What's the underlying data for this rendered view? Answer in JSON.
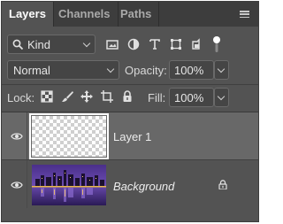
{
  "tabs": [
    {
      "label": "Layers",
      "active": true
    },
    {
      "label": "Channels",
      "active": false
    },
    {
      "label": "Paths",
      "active": false
    }
  ],
  "panel_menu_icon": "hamburger-menu-icon",
  "filter": {
    "search_icon": "search-icon",
    "kind_label": "Kind",
    "filter_icons": [
      "image-filter-icon",
      "adjustment-filter-icon",
      "type-filter-icon",
      "shape-filter-icon",
      "smart-object-filter-icon"
    ],
    "toggle_icon": "filter-toggle-icon"
  },
  "blend": {
    "mode": "Normal",
    "opacity_label": "Opacity:",
    "opacity_value": "100%"
  },
  "lock": {
    "label": "Lock:",
    "icons": [
      "lock-transparent-pixels-icon",
      "lock-image-pixels-icon",
      "lock-position-icon",
      "artboard-nesting-icon",
      "lock-all-icon"
    ],
    "fill_label": "Fill:",
    "fill_value": "100%"
  },
  "layers": [
    {
      "name": "Layer 1",
      "selected": true,
      "visible": true,
      "thumbnail": "transparent",
      "locked": false
    },
    {
      "name": "Background",
      "selected": false,
      "visible": true,
      "thumbnail": "city-skyline-night",
      "locked": true
    }
  ],
  "colors": {
    "panel_bg": "#535353",
    "tabbar_bg": "#3d3d3d",
    "selected_row": "#686868",
    "text": "#d8d8d8"
  }
}
